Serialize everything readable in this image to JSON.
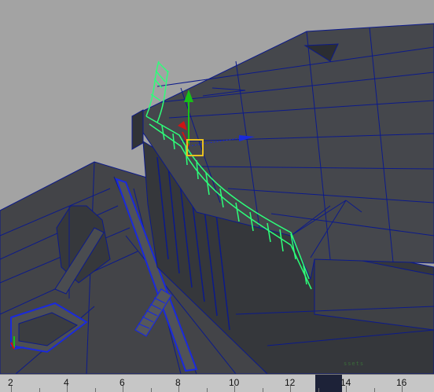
{
  "viewport": {
    "scene_text": "ssets",
    "manipulator_axes": [
      "x",
      "y",
      "z"
    ]
  },
  "timeline": {
    "labels": [
      "2",
      "4",
      "6",
      "8",
      "10",
      "12",
      "14",
      "16"
    ],
    "current_frame": 13
  },
  "colors": {
    "viewport_background": "#a3a3a3",
    "mesh_fill": "#3e4044",
    "wireframe": "#0c1a8a",
    "selection": "#2dff7a",
    "axis_x": "#cc1515",
    "axis_y": "#18c018",
    "axis_z": "#1a2adc",
    "pivot_box": "#e8c020",
    "timeline_bg": "#c6c6c6",
    "time_marker": "#1d2238"
  }
}
